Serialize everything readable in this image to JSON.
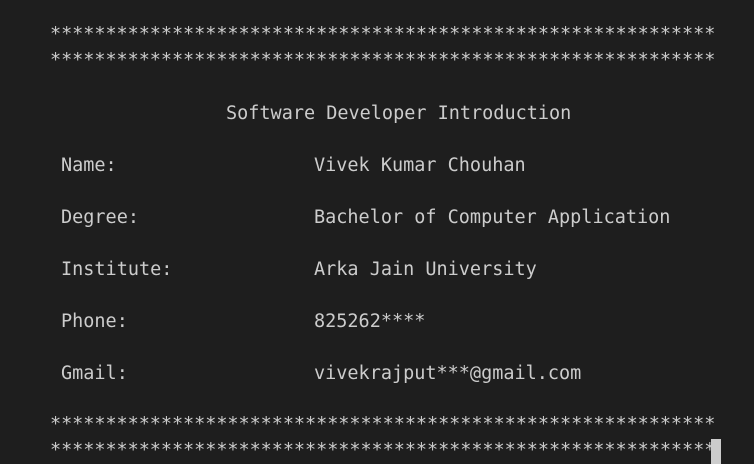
{
  "border": {
    "line_top_1": "************************************************************",
    "line_top_2": "************************************************************",
    "line_bottom_1": "************************************************************",
    "line_bottom_2": "************************************************************"
  },
  "title": "Software Developer Introduction",
  "fields": [
    {
      "label": "Name:",
      "value": "Vivek Kumar Chouhan"
    },
    {
      "label": "Degree:",
      "value": "Bachelor of Computer Application"
    },
    {
      "label": "Institute:",
      "value": "Arka Jain University"
    },
    {
      "label": "Phone:",
      "value": "825262****"
    },
    {
      "label": "Gmail:",
      "value": "vivekrajput***@gmail.com"
    }
  ],
  "colors": {
    "background": "#1e1e1e",
    "text": "#cccccc",
    "cursor": "#cccccc"
  }
}
